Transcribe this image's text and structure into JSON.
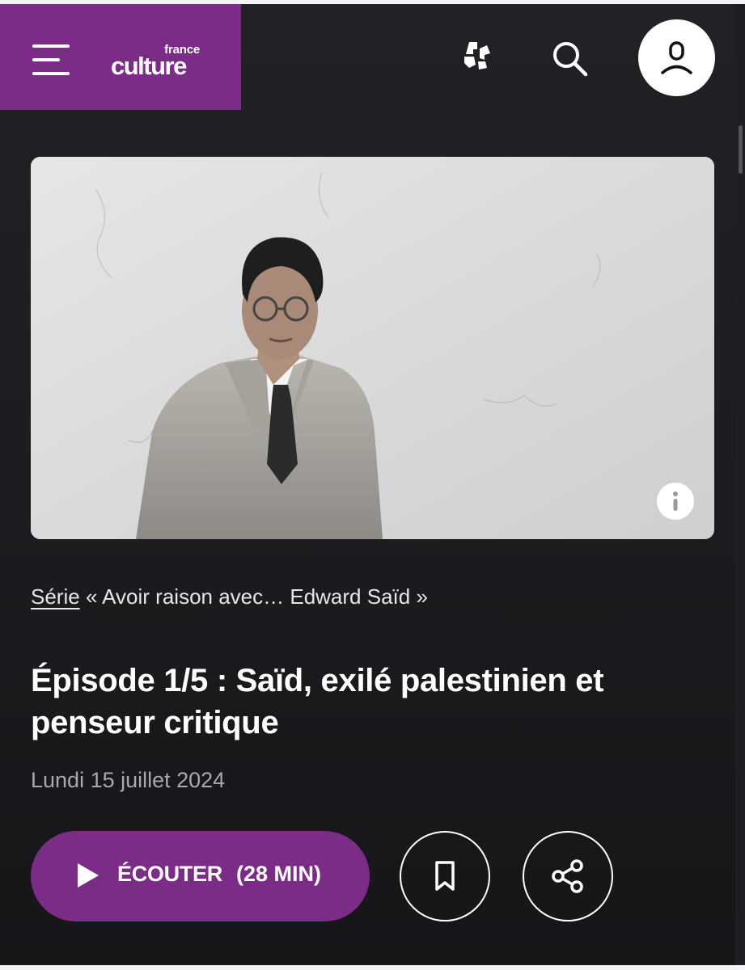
{
  "header": {
    "logo_small": "france",
    "logo_big": "culture"
  },
  "hero": {
    "icons": [
      "info-icon"
    ]
  },
  "series": {
    "link_label": "Série",
    "name": "« Avoir raison avec… Edward Saïd »"
  },
  "episode": {
    "title": "Épisode 1/5 : Saïd, exilé palestinien et penseur critique",
    "date": "Lundi 15 juillet 2024"
  },
  "actions": {
    "listen_label": "ÉCOUTER",
    "listen_duration": "(28 MIN)"
  },
  "colors": {
    "brand": "#7b2c87",
    "background": "#1b1b1f",
    "text": "#ffffff",
    "muted": "#a8a8ad"
  },
  "icons": {
    "menu": "hamburger-icon",
    "radio": "radio-france-logo-icon",
    "search": "search-icon",
    "account": "user-account-icon",
    "play": "play-icon",
    "bookmark": "bookmark-icon",
    "share": "share-icon"
  }
}
